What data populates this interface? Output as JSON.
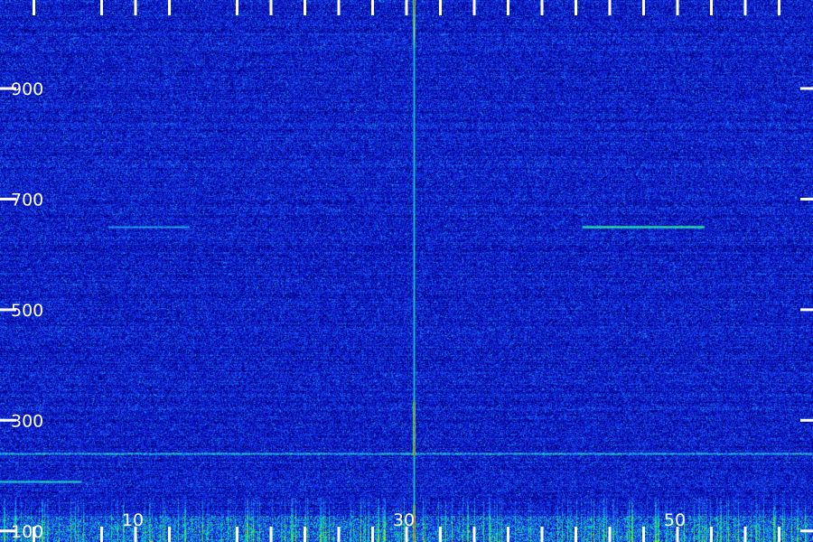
{
  "chart_data": {
    "type": "heatmap",
    "title": "",
    "xlabel": "",
    "ylabel": "",
    "xlim": [
      0,
      60
    ],
    "ylim": [
      80,
      1060
    ],
    "x_ticks": [
      {
        "value": 10,
        "label": "10"
      },
      {
        "value": 30,
        "label": "30"
      },
      {
        "value": 50,
        "label": "50"
      }
    ],
    "x_tick_marks": [
      2.5,
      7.5,
      10,
      12.5,
      17.5,
      20,
      22.5,
      25,
      27.5,
      30,
      32.5,
      35,
      37.5,
      40,
      42.5,
      45,
      47.5,
      50,
      52.5,
      55,
      57.5
    ],
    "y_ticks": [
      {
        "value": 100,
        "label": "100"
      },
      {
        "value": 300,
        "label": "300"
      },
      {
        "value": 500,
        "label": "500"
      },
      {
        "value": 700,
        "label": "700"
      },
      {
        "value": 900,
        "label": "900"
      }
    ],
    "colormap": [
      "#000010",
      "#00008c",
      "#1428e6",
      "#1e8cf0",
      "#00dcb4",
      "#32f032",
      "#e6e600",
      "#ff8c00",
      "#ff1e00"
    ],
    "features": [
      {
        "kind": "vertical_line",
        "x": 30.5,
        "y_range": [
          80,
          1060
        ],
        "intensity_low": 0.55,
        "intensity_high": 1.0
      },
      {
        "kind": "horizontal_segment",
        "y": 650,
        "x_range": [
          43,
          52
        ],
        "intensity": 0.62
      },
      {
        "kind": "horizontal_segment",
        "y": 650,
        "x_range": [
          8,
          14
        ],
        "intensity": 0.45
      },
      {
        "kind": "horizontal_segment",
        "y": 190,
        "x_range": [
          0,
          6
        ],
        "intensity": 0.55
      },
      {
        "kind": "horizontal_band",
        "y": 240,
        "x_range": [
          0,
          60
        ],
        "intensity": 0.45
      },
      {
        "kind": "low_band",
        "y_range": [
          80,
          160
        ],
        "x_range": [
          0,
          60
        ],
        "intensity": 0.72
      }
    ]
  }
}
